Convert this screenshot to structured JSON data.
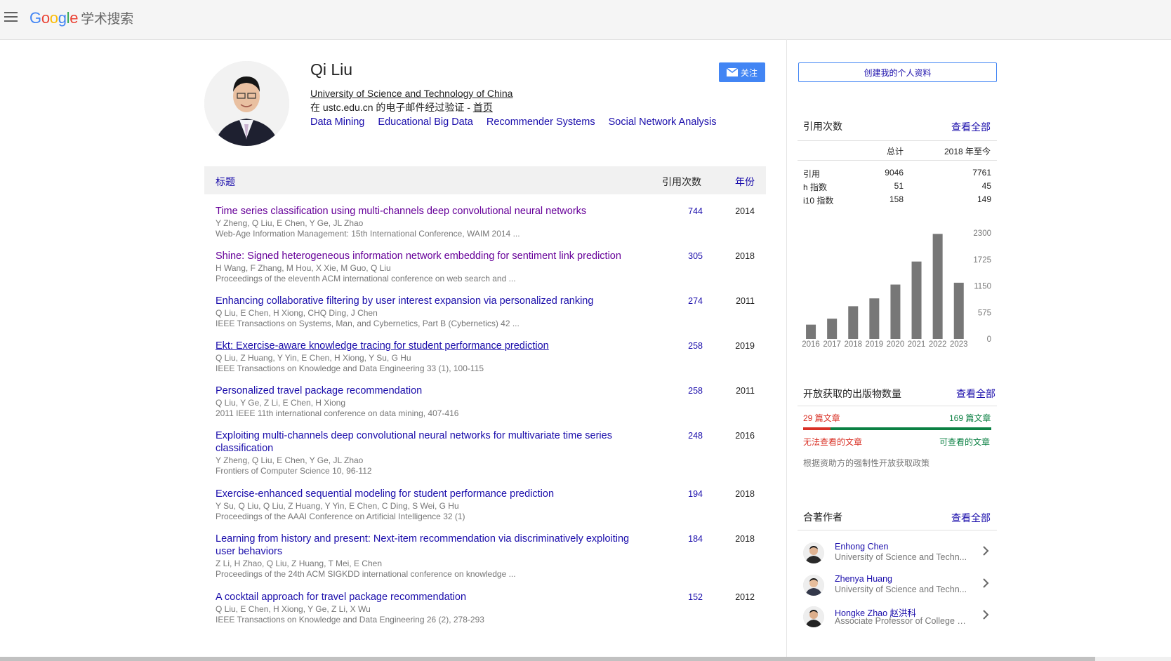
{
  "header": {
    "logo_letters": [
      "G",
      "o",
      "o",
      "g",
      "l",
      "e"
    ],
    "scholar_label": "学术搜索"
  },
  "profile": {
    "name": "Qi Liu",
    "affiliation": "University of Science and Technology of China",
    "verified_prefix": "在 ustc.edu.cn 的电子邮件经过验证 - ",
    "homepage_label": "首页",
    "interests": [
      "Data Mining",
      "Educational Big Data",
      "Recommender Systems",
      "Social Network Analysis"
    ],
    "follow_label": "关注"
  },
  "table": {
    "col_title": "标题",
    "col_cited": "引用次数",
    "col_year": "年份"
  },
  "publications": [
    {
      "title": "Time series classification using multi-channels deep convolutional neural networks",
      "authors": "Y Zheng, Q Liu, E Chen, Y Ge, JL Zhao",
      "venue": "Web-Age Information Management: 15th International Conference, WAIM 2014 ...",
      "cited": "744",
      "year": "2014",
      "state": "visited"
    },
    {
      "title": "Shine: Signed heterogeneous information network embedding for sentiment link prediction",
      "authors": "H Wang, F Zhang, M Hou, X Xie, M Guo, Q Liu",
      "venue": "Proceedings of the eleventh ACM international conference on web search and ...",
      "cited": "305",
      "year": "2018",
      "state": "visited"
    },
    {
      "title": "Enhancing collaborative filtering by user interest expansion via personalized ranking",
      "authors": "Q Liu, E Chen, H Xiong, CHQ Ding, J Chen",
      "venue": "IEEE Transactions on Systems, Man, and Cybernetics, Part B (Cybernetics) 42 ...",
      "cited": "274",
      "year": "2011",
      "state": "normal"
    },
    {
      "title": "Ekt: Exercise-aware knowledge tracing for student performance prediction",
      "authors": "Q Liu, Z Huang, Y Yin, E Chen, H Xiong, Y Su, G Hu",
      "venue": "IEEE Transactions on Knowledge and Data Engineering 33 (1), 100-115",
      "cited": "258",
      "year": "2019",
      "state": "hover"
    },
    {
      "title": "Personalized travel package recommendation",
      "authors": "Q Liu, Y Ge, Z Li, E Chen, H Xiong",
      "venue": "2011 IEEE 11th international conference on data mining, 407-416",
      "cited": "258",
      "year": "2011",
      "state": "normal"
    },
    {
      "title": "Exploiting multi-channels deep convolutional neural networks for multivariate time series classification",
      "authors": "Y Zheng, Q Liu, E Chen, Y Ge, JL Zhao",
      "venue": "Frontiers of Computer Science 10, 96-112",
      "cited": "248",
      "year": "2016",
      "state": "normal"
    },
    {
      "title": "Exercise-enhanced sequential modeling for student performance prediction",
      "authors": "Y Su, Q Liu, Q Liu, Z Huang, Y Yin, E Chen, C Ding, S Wei, G Hu",
      "venue": "Proceedings of the AAAI Conference on Artificial Intelligence 32 (1)",
      "cited": "194",
      "year": "2018",
      "state": "normal"
    },
    {
      "title": "Learning from history and present: Next-item recommendation via discriminatively exploiting user behaviors",
      "authors": "Z Li, H Zhao, Q Liu, Z Huang, T Mei, E Chen",
      "venue": "Proceedings of the 24th ACM SIGKDD international conference on knowledge ...",
      "cited": "184",
      "year": "2018",
      "state": "normal"
    },
    {
      "title": "A cocktail approach for travel package recommendation",
      "authors": "Q Liu, E Chen, H Xiong, Y Ge, Z Li, X Wu",
      "venue": "IEEE Transactions on Knowledge and Data Engineering 26 (2), 278-293",
      "cited": "152",
      "year": "2012",
      "state": "normal"
    }
  ],
  "sidebar": {
    "create_profile_label": "创建我的个人资料",
    "citations": {
      "title": "引用次数",
      "view_all": "查看全部",
      "col_total": "总计",
      "col_since": "2018 年至今",
      "rows": [
        {
          "label": "引用",
          "total": "9046",
          "since": "7761"
        },
        {
          "label": "h 指数",
          "total": "51",
          "since": "45"
        },
        {
          "label": "i10 指数",
          "total": "158",
          "since": "149"
        }
      ]
    },
    "open_access": {
      "title": "开放获取的出版物数量",
      "view_all": "查看全部",
      "unavailable_count": "29 篇文章",
      "available_count": "169 篇文章",
      "unavailable_label": "无法查看的文章",
      "available_label": "可查看的文章",
      "available_fraction": 0.853,
      "mandate_note": "根据资助方的强制性开放获取政策"
    },
    "coauthors": {
      "title": "合著作者",
      "view_all": "查看全部",
      "items": [
        {
          "name": "Enhong Chen",
          "affiliation": "University of Science and Techn..."
        },
        {
          "name": "Zhenya Huang",
          "affiliation": "University of Science and Techn..."
        },
        {
          "name": "Hongke Zhao 赵洪科",
          "affiliation": "Associate Professor of College o..."
        }
      ]
    }
  },
  "chart_data": {
    "type": "bar",
    "categories": [
      "2016",
      "2017",
      "2018",
      "2019",
      "2020",
      "2021",
      "2022",
      "2023"
    ],
    "values": [
      310,
      440,
      710,
      880,
      1180,
      1680,
      2280,
      1220
    ],
    "ylim": [
      0,
      2300
    ],
    "yticks": [
      "0",
      "575",
      "1150",
      "1725",
      "2300"
    ],
    "bar_color": "#777777"
  },
  "colors": {
    "link": "#1a0dab",
    "visited": "#660099",
    "accent_blue": "#4285f4",
    "oa_red": "#d93025",
    "oa_green": "#0b8043"
  }
}
